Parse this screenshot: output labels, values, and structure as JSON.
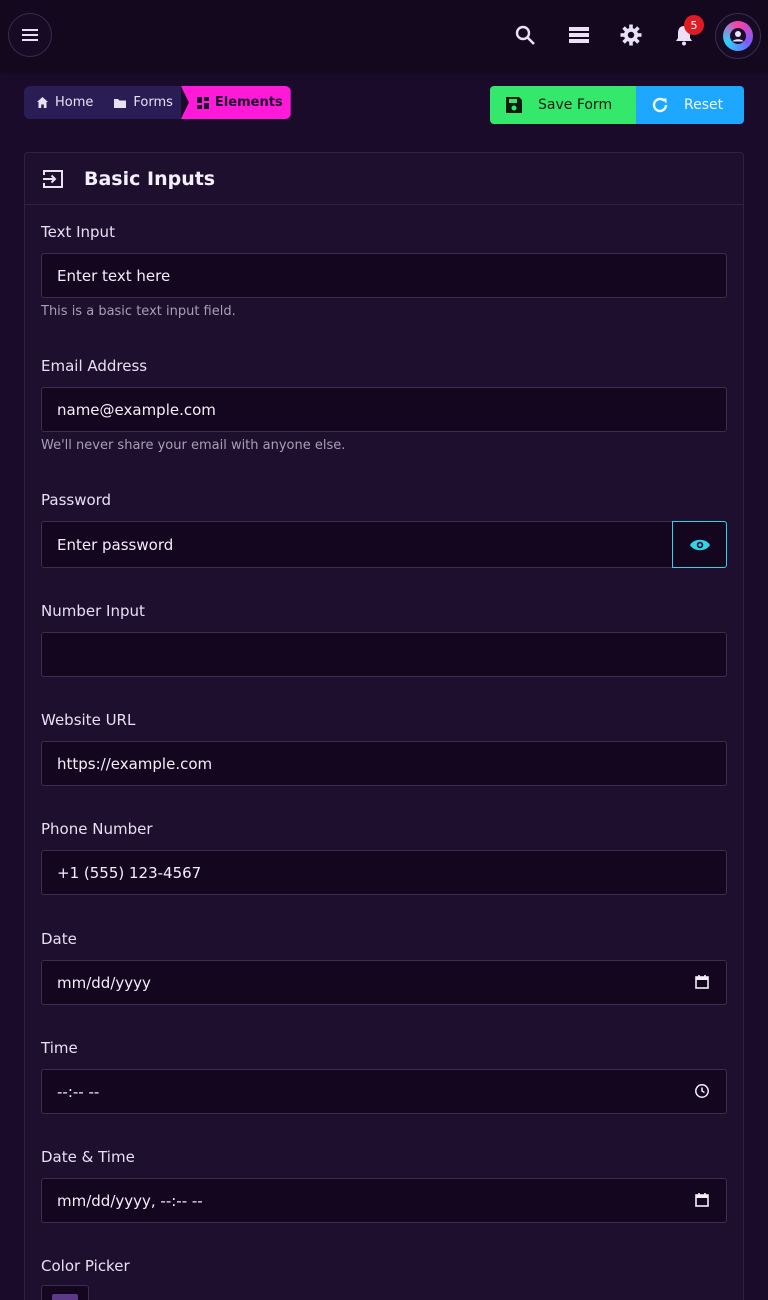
{
  "topbar": {
    "menu_icon": "hamburger-menu-icon",
    "search_icon": "search-icon",
    "layers_icon": "storage-icon",
    "settings_icon": "gear-icon",
    "notifications_icon": "bell-icon",
    "notification_count": "5",
    "avatar_icon": "user-avatar-icon"
  },
  "breadcrumb": {
    "home": "Home",
    "forms": "Forms",
    "elements": "Elements"
  },
  "actions": {
    "save": "Save Form",
    "reset": "Reset"
  },
  "card": {
    "title": "Basic Inputs"
  },
  "fields": {
    "text": {
      "label": "Text Input",
      "placeholder": "Enter text here",
      "help": "This is a basic text input field."
    },
    "email": {
      "label": "Email Address",
      "placeholder": "name@example.com",
      "help": "We'll never share your email with anyone else."
    },
    "password": {
      "label": "Password",
      "placeholder": "Enter password"
    },
    "number": {
      "label": "Number Input",
      "value": ""
    },
    "url": {
      "label": "Website URL",
      "placeholder": "https://example.com"
    },
    "phone": {
      "label": "Phone Number",
      "placeholder": "+1 (555) 123-4567"
    },
    "date": {
      "label": "Date",
      "placeholder": "mm/dd/yyyy"
    },
    "time": {
      "label": "Time",
      "placeholder": "--:-- --"
    },
    "datetime": {
      "label": "Date & Time",
      "placeholder": "mm/dd/yyyy, --:-- --"
    },
    "color": {
      "label": "Color Picker"
    }
  },
  "colors": {
    "save": "#33e86a",
    "reset": "#1ea7ff",
    "breadcrumb_active": "#ff1ad9",
    "accent_eye": "#2fd5e6",
    "badge": "#e01b24"
  }
}
